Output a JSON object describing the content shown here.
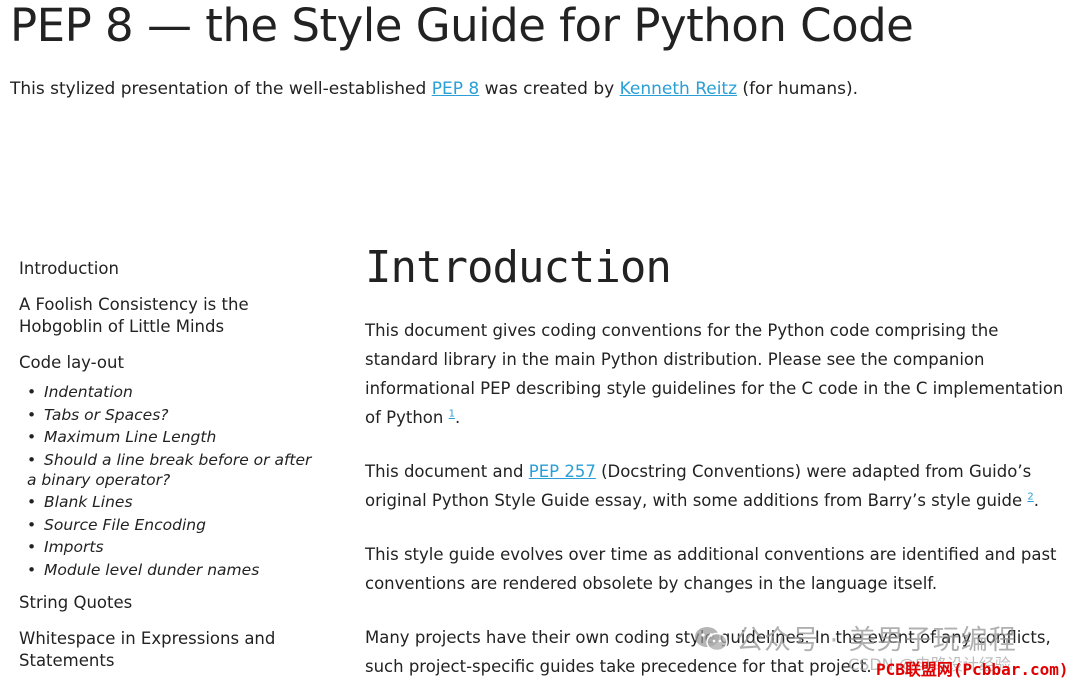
{
  "header": {
    "title": "PEP 8 — the Style Guide for Python Code",
    "intro_prefix": "This stylized presentation of the well-established ",
    "pep8_link": "PEP 8",
    "intro_middle": " was created by ",
    "author_link": "Kenneth Reitz",
    "intro_suffix": " (for humans)."
  },
  "toc": {
    "item_introduction": "Introduction",
    "item_foolish": "A Foolish Consistency is the Hobgoblin of Little Minds",
    "item_code_layout": "Code lay-out",
    "subitems": [
      "Indentation",
      "Tabs or Spaces?",
      "Maximum Line Length",
      "Should a line break before or after a binary operator?",
      "Blank Lines",
      "Source File Encoding",
      "Imports",
      "Module level dunder names"
    ],
    "item_string_quotes": "String Quotes",
    "item_whitespace": "Whitespace in Expressions and Statements",
    "bullet": "•"
  },
  "content": {
    "heading": "Introduction",
    "p1_text": "This document gives coding conventions for the Python code comprising the standard library in the main Python distribution. Please see the companion informational PEP describing style guidelines for the C code in the C implementation of Python ",
    "p1_fn": "1",
    "p1_end": ".",
    "p2_prefix": "This document and ",
    "p2_link": "PEP 257",
    "p2_text": " (Docstring Conventions) were adapted from Guido’s original Python Style Guide essay, with some additions from Barry’s style guide ",
    "p2_fn": "2",
    "p2_end": ".",
    "p3_text": "This style guide evolves over time as additional conventions are identified and past conventions are rendered obsolete by changes in the language itself.",
    "p4_text": "Many projects have their own coding style guidelines. In the event of any conflicts, such project-specific guides take precedence for that project."
  },
  "watermarks": {
    "wechat": "公众号 · 美男子玩编程",
    "csdn": "CSDN @电路设计经验",
    "pcb": "PCB联盟网(Pcbbar.com)"
  },
  "colors": {
    "link": "#2a9fd6",
    "text": "#222222",
    "pcb_watermark": "#e00000"
  }
}
